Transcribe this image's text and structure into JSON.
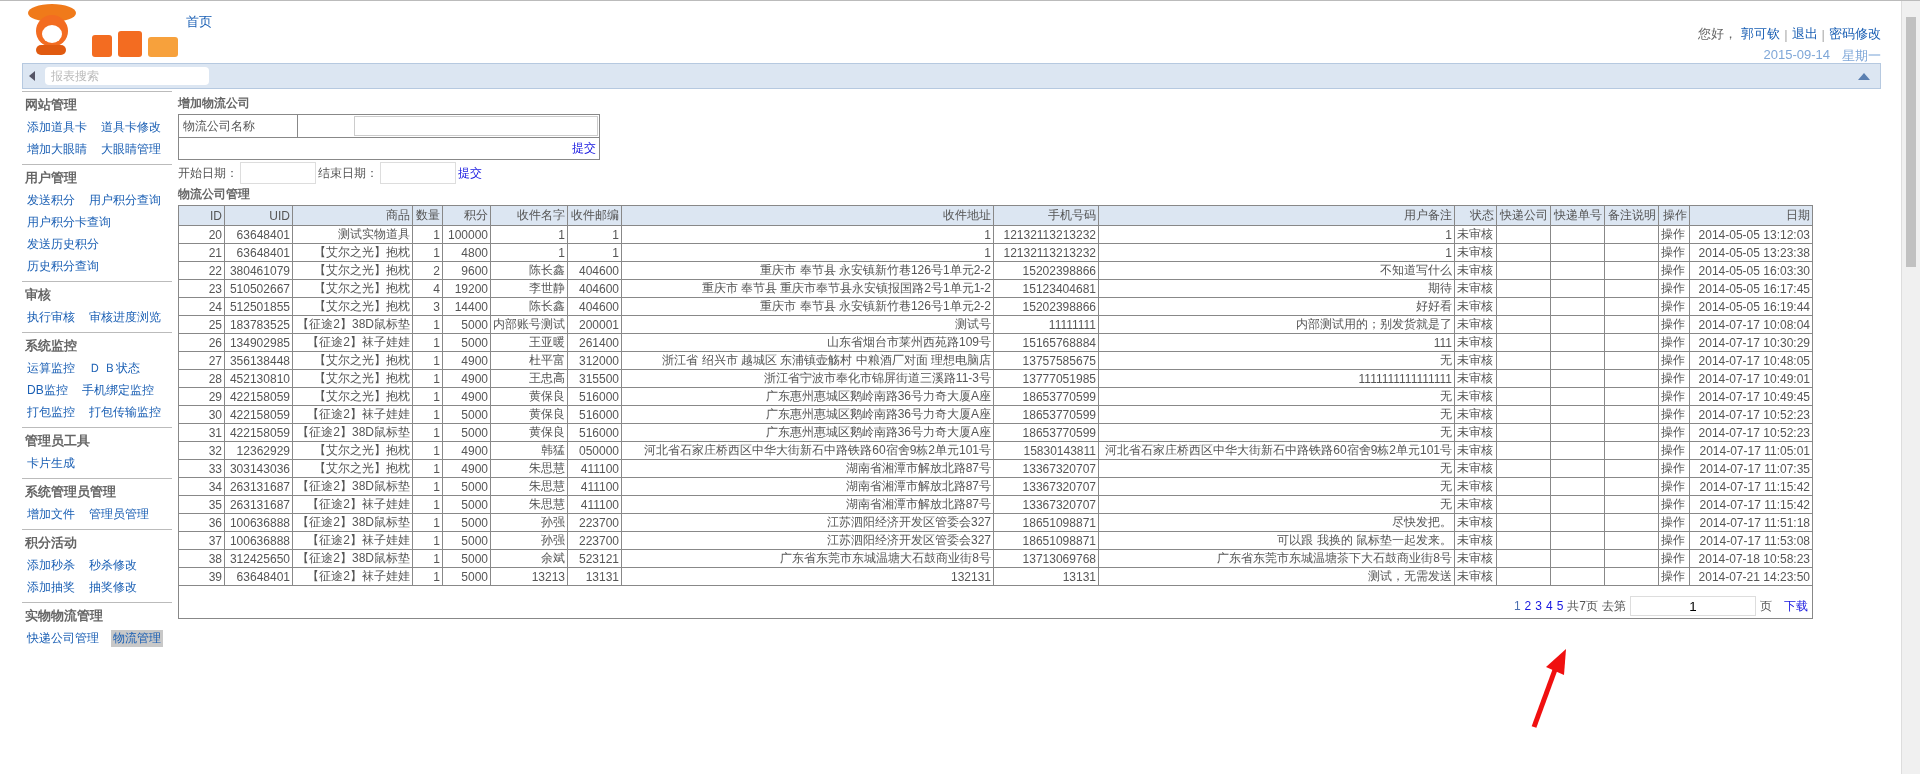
{
  "header": {
    "home_link": "首页",
    "greeting": "您好，",
    "user": "郭可钦",
    "separator": "|",
    "links": [
      "退出",
      "密码修改"
    ],
    "date": "2015-09-14",
    "weekday": "星期一"
  },
  "search": {
    "placeholder": "报表搜索"
  },
  "sidebar": {
    "sections": [
      {
        "title": "网站管理",
        "rows": [
          [
            {
              "label": "添加道具卡",
              "selected": false
            },
            {
              "label": "道具卡修改",
              "selected": false
            }
          ],
          [
            {
              "label": "增加大眼睛",
              "selected": false
            },
            {
              "label": "大眼睛管理",
              "selected": false
            }
          ]
        ]
      },
      {
        "title": "用户管理",
        "rows": [
          [
            {
              "label": "发送积分",
              "selected": false
            },
            {
              "label": "用户积分查询",
              "selected": false
            }
          ],
          [
            {
              "label": "用户积分卡查询",
              "selected": false
            }
          ],
          [
            {
              "label": "发送历史积分",
              "selected": false
            }
          ],
          [
            {
              "label": "历史积分查询",
              "selected": false
            }
          ]
        ]
      },
      {
        "title": "审核",
        "rows": [
          [
            {
              "label": "执行审核",
              "selected": false
            },
            {
              "label": "审核进度浏览",
              "selected": false
            }
          ]
        ]
      },
      {
        "title": "系统监控",
        "rows": [
          [
            {
              "label": "运算监控",
              "selected": false
            },
            {
              "label": "Ｄ Ｂ状态",
              "selected": false
            }
          ],
          [
            {
              "label": "DB监控",
              "selected": false
            },
            {
              "label": "手机绑定监控",
              "selected": false
            }
          ],
          [
            {
              "label": "打包监控",
              "selected": false
            },
            {
              "label": "打包传输监控",
              "selected": false
            }
          ]
        ]
      },
      {
        "title": "管理员工具",
        "rows": [
          [
            {
              "label": "卡片生成",
              "selected": false
            }
          ]
        ]
      },
      {
        "title": "系统管理员管理",
        "rows": [
          [
            {
              "label": "增加文件",
              "selected": false
            },
            {
              "label": "管理员管理",
              "selected": false
            }
          ]
        ]
      },
      {
        "title": "积分活动",
        "rows": [
          [
            {
              "label": "添加秒杀",
              "selected": false
            },
            {
              "label": "秒杀修改",
              "selected": false
            }
          ],
          [
            {
              "label": "添加抽奖",
              "selected": false
            },
            {
              "label": "抽奖修改",
              "selected": false
            }
          ]
        ]
      },
      {
        "title": "实物物流管理",
        "rows": [
          [
            {
              "label": "快递公司管理",
              "selected": false
            },
            {
              "label": "物流管理",
              "selected": true
            }
          ]
        ]
      }
    ]
  },
  "add_form": {
    "title": "增加物流公司",
    "field_label": "物流公司名称",
    "submit": "提交"
  },
  "date_filter": {
    "start_label": "开始日期：",
    "end_label": "结束日期：",
    "submit": "提交"
  },
  "table": {
    "title": "物流公司管理",
    "columns": [
      "ID",
      "UID",
      "商品",
      "数量",
      "积分",
      "收件名字",
      "收件邮编",
      "收件地址",
      "手机号码",
      "用户备注",
      "状态",
      "快递公司",
      "快递单号",
      "备注说明",
      "操作",
      "日期"
    ],
    "rows": [
      {
        "id": "20",
        "uid": "63648401",
        "product": "测试实物道具",
        "qty": "1",
        "points": "100000",
        "name": "1",
        "zip": "1",
        "address": "1",
        "phone": "12132113213232",
        "remark": "1",
        "status": "未审核",
        "action": "操作",
        "date": "2014-05-05 13:12:03"
      },
      {
        "id": "21",
        "uid": "63648401",
        "product": "【艾尔之光】抱枕",
        "qty": "1",
        "points": "4800",
        "name": "1",
        "zip": "1",
        "address": "1",
        "phone": "12132113213232",
        "remark": "1",
        "status": "未审核",
        "action": "操作",
        "date": "2014-05-05 13:23:38"
      },
      {
        "id": "22",
        "uid": "380461079",
        "product": "【艾尔之光】抱枕",
        "qty": "2",
        "points": "9600",
        "name": "陈长鑫",
        "zip": "404600",
        "address": "重庆市 奉节县 永安镇新竹巷126号1单元2-2",
        "phone": "15202398866",
        "remark": "不知道写什么",
        "status": "未审核",
        "action": "操作",
        "date": "2014-05-05 16:03:30"
      },
      {
        "id": "23",
        "uid": "510502667",
        "product": "【艾尔之光】抱枕",
        "qty": "4",
        "points": "19200",
        "name": "李世静",
        "zip": "404600",
        "address": "重庆市 奉节县 重庆市奉节县永安镇报国路2号1单元1-2",
        "phone": "15123404681",
        "remark": "期待",
        "status": "未审核",
        "action": "操作",
        "date": "2014-05-05 16:17:45"
      },
      {
        "id": "24",
        "uid": "512501855",
        "product": "【艾尔之光】抱枕",
        "qty": "3",
        "points": "14400",
        "name": "陈长鑫",
        "zip": "404600",
        "address": "重庆市 奉节县 永安镇新竹巷126号1单元2-2",
        "phone": "15202398866",
        "remark": "好好看",
        "status": "未审核",
        "action": "操作",
        "date": "2014-05-05 16:19:44"
      },
      {
        "id": "25",
        "uid": "183783525",
        "product": "【征途2】38D鼠标垫",
        "qty": "1",
        "points": "5000",
        "name": "内部账号测试",
        "zip": "200001",
        "address": "测试号",
        "phone": "11111111",
        "remark": "内部测试用的；别发货就是了",
        "status": "未审核",
        "action": "操作",
        "date": "2014-07-17 10:08:04"
      },
      {
        "id": "26",
        "uid": "134902985",
        "product": "【征途2】袜子娃娃",
        "qty": "1",
        "points": "5000",
        "name": "王亚暖",
        "zip": "261400",
        "address": "山东省烟台市莱州西苑路109号",
        "phone": "15165768884",
        "remark": "111",
        "status": "未审核",
        "action": "操作",
        "date": "2014-07-17 10:30:29"
      },
      {
        "id": "27",
        "uid": "356138448",
        "product": "【艾尔之光】抱枕",
        "qty": "1",
        "points": "4900",
        "name": "杜平富",
        "zip": "312000",
        "address": "浙江省 绍兴市 越城区 东浦镇壶觞村 中粮酒厂对面 理想电脑店",
        "phone": "13757585675",
        "remark": "无",
        "status": "未审核",
        "action": "操作",
        "date": "2014-07-17 10:48:05"
      },
      {
        "id": "28",
        "uid": "452130810",
        "product": "【艾尔之光】抱枕",
        "qty": "1",
        "points": "4900",
        "name": "王忠高",
        "zip": "315500",
        "address": "浙江省宁波市奉化市锦屏街道三溪路11-3号",
        "phone": "13777051985",
        "remark": "1111111111111111",
        "status": "未审核",
        "action": "操作",
        "date": "2014-07-17 10:49:01"
      },
      {
        "id": "29",
        "uid": "422158059",
        "product": "【艾尔之光】抱枕",
        "qty": "1",
        "points": "4900",
        "name": "黄保良",
        "zip": "516000",
        "address": "广东惠州惠城区鹅岭南路36号力奇大厦A座",
        "phone": "18653770599",
        "remark": "无",
        "status": "未审核",
        "action": "操作",
        "date": "2014-07-17 10:49:45"
      },
      {
        "id": "30",
        "uid": "422158059",
        "product": "【征途2】袜子娃娃",
        "qty": "1",
        "points": "5000",
        "name": "黄保良",
        "zip": "516000",
        "address": "广东惠州惠城区鹅岭南路36号力奇大厦A座",
        "phone": "18653770599",
        "remark": "无",
        "status": "未审核",
        "action": "操作",
        "date": "2014-07-17 10:52:23"
      },
      {
        "id": "31",
        "uid": "422158059",
        "product": "【征途2】38D鼠标垫",
        "qty": "1",
        "points": "5000",
        "name": "黄保良",
        "zip": "516000",
        "address": "广东惠州惠城区鹅岭南路36号力奇大厦A座",
        "phone": "18653770599",
        "remark": "无",
        "status": "未审核",
        "action": "操作",
        "date": "2014-07-17 10:52:23"
      },
      {
        "id": "32",
        "uid": "12362929",
        "product": "【艾尔之光】抱枕",
        "qty": "1",
        "points": "4900",
        "name": "韩猛",
        "zip": "050000",
        "address": "河北省石家庄桥西区中华大街新石中路铁路60宿舍9栋2单元101号",
        "phone": "15830143811",
        "remark": "河北省石家庄桥西区中华大街新石中路铁路60宿舍9栋2单元101号",
        "status": "未审核",
        "action": "操作",
        "date": "2014-07-17 11:05:01"
      },
      {
        "id": "33",
        "uid": "303143036",
        "product": "【艾尔之光】抱枕",
        "qty": "1",
        "points": "4900",
        "name": "朱思慧",
        "zip": "411100",
        "address": "湖南省湘潭市解放北路87号",
        "phone": "13367320707",
        "remark": "无",
        "status": "未审核",
        "action": "操作",
        "date": "2014-07-17 11:07:35"
      },
      {
        "id": "34",
        "uid": "263131687",
        "product": "【征途2】38D鼠标垫",
        "qty": "1",
        "points": "5000",
        "name": "朱思慧",
        "zip": "411100",
        "address": "湖南省湘潭市解放北路87号",
        "phone": "13367320707",
        "remark": "无",
        "status": "未审核",
        "action": "操作",
        "date": "2014-07-17 11:15:42"
      },
      {
        "id": "35",
        "uid": "263131687",
        "product": "【征途2】袜子娃娃",
        "qty": "1",
        "points": "5000",
        "name": "朱思慧",
        "zip": "411100",
        "address": "湖南省湘潭市解放北路87号",
        "phone": "13367320707",
        "remark": "无",
        "status": "未审核",
        "action": "操作",
        "date": "2014-07-17 11:15:42"
      },
      {
        "id": "36",
        "uid": "100636888",
        "product": "【征途2】38D鼠标垫",
        "qty": "1",
        "points": "5000",
        "name": "孙强",
        "zip": "223700",
        "address": "江苏泗阳经济开发区管委会327",
        "phone": "18651098871",
        "remark": "尽快发把。",
        "status": "未审核",
        "action": "操作",
        "date": "2014-07-17 11:51:18"
      },
      {
        "id": "37",
        "uid": "100636888",
        "product": "【征途2】袜子娃娃",
        "qty": "1",
        "points": "5000",
        "name": "孙强",
        "zip": "223700",
        "address": "江苏泗阳经济开发区管委会327",
        "phone": "18651098871",
        "remark": "可以跟 我换的 鼠标垫一起发来。",
        "status": "未审核",
        "action": "操作",
        "date": "2014-07-17 11:53:08"
      },
      {
        "id": "38",
        "uid": "312425650",
        "product": "【征途2】38D鼠标垫",
        "qty": "1",
        "points": "5000",
        "name": "余斌",
        "zip": "523121",
        "address": "广东省东莞市东城温塘大石鼓商业街8号",
        "phone": "13713069768",
        "remark": "广东省东莞市东城温塘茶下大石鼓商业街8号",
        "status": "未审核",
        "action": "操作",
        "date": "2014-07-18 10:58:23"
      },
      {
        "id": "39",
        "uid": "63648401",
        "product": "【征途2】袜子娃娃",
        "qty": "1",
        "points": "5000",
        "name": "13213",
        "zip": "13131",
        "address": "132131",
        "phone": "13131",
        "remark": "测试，无需发送",
        "status": "未审核",
        "action": "操作",
        "date": "2014-07-21 14:23:50"
      }
    ]
  },
  "pagination": {
    "pages": [
      {
        "label": "1",
        "selected": true
      },
      {
        "label": "2",
        "selected": false
      },
      {
        "label": "3",
        "selected": false
      },
      {
        "label": "4",
        "selected": false
      },
      {
        "label": "5",
        "selected": false
      }
    ],
    "total": "共7页",
    "goto_label": "去第",
    "goto_value": "1",
    "page_suffix": "页",
    "download": "下载"
  }
}
